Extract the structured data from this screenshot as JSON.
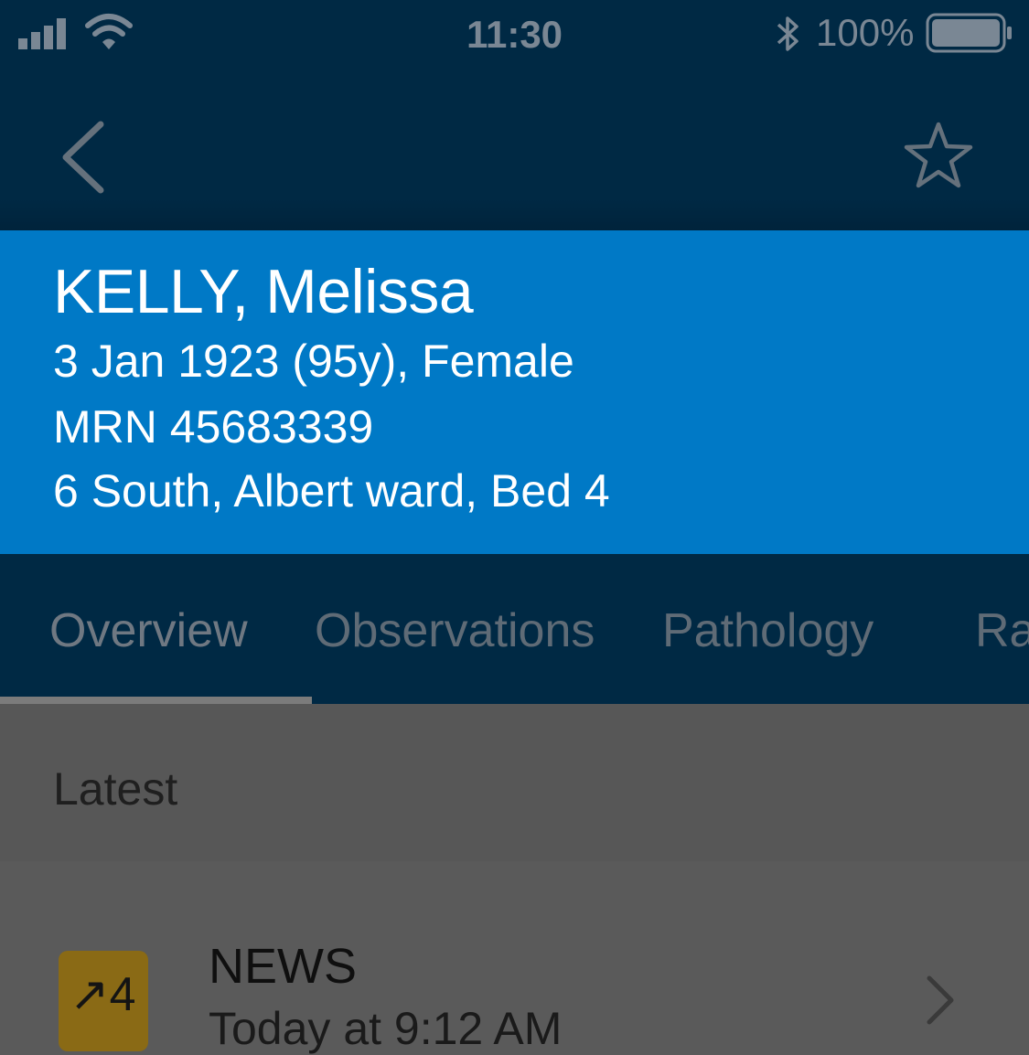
{
  "status_bar": {
    "time": "11:30",
    "battery_percent": "100%",
    "icons": [
      "signal-icon",
      "wifi-icon",
      "bluetooth-icon",
      "battery-icon"
    ]
  },
  "nav_bar": {
    "icons": [
      "back-chevron-icon",
      "star-icon"
    ]
  },
  "patient": {
    "name": "KELLY, Melissa",
    "dob_line": "3 Jan 1923 (95y), Female",
    "mrn": "MRN 45683339",
    "location": "6 South, Albert ward, Bed 4"
  },
  "tabs": [
    {
      "label": "Overview",
      "selected": true
    },
    {
      "label": "Observations",
      "selected": false
    },
    {
      "label": "Pathology",
      "selected": false
    },
    {
      "label": "Ra",
      "selected": false
    }
  ],
  "latest": {
    "label": "Latest"
  },
  "news": {
    "badge": "↗4",
    "title": "NEWS",
    "subtitle": "Today at 9:12 AM"
  },
  "colors": {
    "nav_background": "#002944",
    "patient_header": "#0079c6",
    "badge": "#8a6a15"
  }
}
